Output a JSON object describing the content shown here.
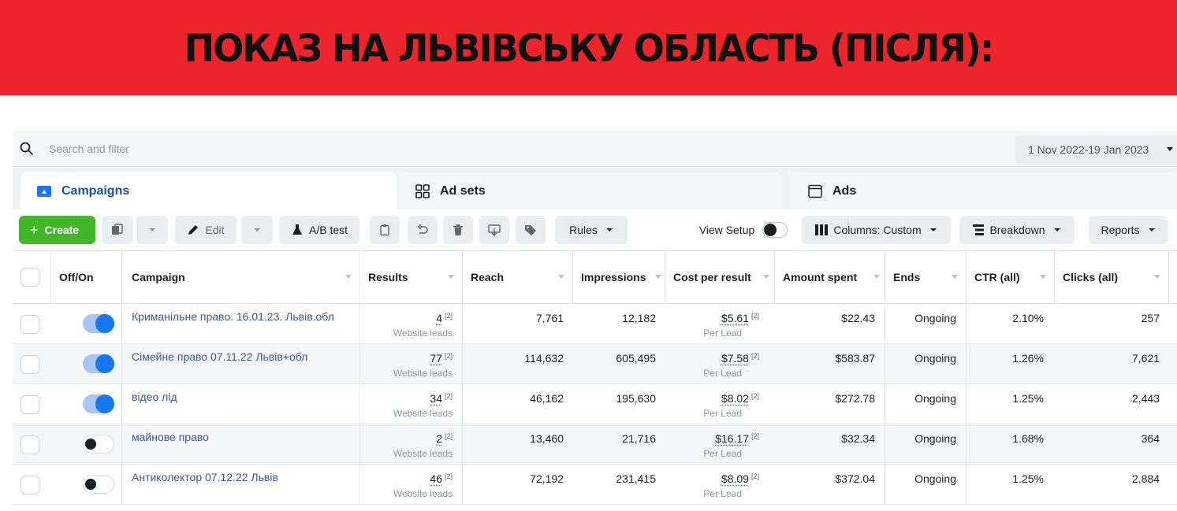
{
  "banner": {
    "title": "ПОКАЗ НА ЛЬВІВСЬКУ ОБЛАСТЬ (ПІСЛЯ):"
  },
  "search": {
    "placeholder": "Search and filter"
  },
  "date_range": "1 Nov 2022-19 Jan 2023",
  "tabs": [
    {
      "label": "Campaigns",
      "icon": "folder-icon",
      "active": true
    },
    {
      "label": "Ad sets",
      "icon": "grid-icon",
      "active": false
    },
    {
      "label": "Ads",
      "icon": "ad-window-icon",
      "active": false
    }
  ],
  "toolbar": {
    "create_label": "Create",
    "edit_label": "Edit",
    "ab_test_label": "A/B test",
    "rules_label": "Rules",
    "view_setup_label": "View Setup",
    "columns_label": "Columns: Custom",
    "breakdown_label": "Breakdown",
    "reports_label": "Reports"
  },
  "columns": [
    "Off/On",
    "Campaign",
    "Results",
    "Reach",
    "Impressions",
    "Cost per result",
    "Amount spent",
    "Ends",
    "CTR (all)",
    "Clicks (all)"
  ],
  "rows": [
    {
      "on": true,
      "campaign": "Криманільне право. 16.01.23. Львів.обл",
      "results": "4",
      "results_sub": "Website leads",
      "reach": "7,761",
      "impressions": "12,182",
      "cpr": "$5.61",
      "cpr_sub": "Per Lead",
      "spent": "$22.43",
      "ends": "Ongoing",
      "ctr": "2.10%",
      "clicks": "257"
    },
    {
      "on": true,
      "campaign": "Сімейне право 07.11.22 Львів+обл",
      "results": "77",
      "results_sub": "Website leads",
      "reach": "114,632",
      "impressions": "605,495",
      "cpr": "$7.58",
      "cpr_sub": "Per Lead",
      "spent": "$583.87",
      "ends": "Ongoing",
      "ctr": "1.26%",
      "clicks": "7,621"
    },
    {
      "on": true,
      "campaign": "відео лід",
      "results": "34",
      "results_sub": "Website leads",
      "reach": "46,162",
      "impressions": "195,630",
      "cpr": "$8.02",
      "cpr_sub": "Per Lead",
      "spent": "$272.78",
      "ends": "Ongoing",
      "ctr": "1.25%",
      "clicks": "2,443"
    },
    {
      "on": false,
      "campaign": "майнове право",
      "results": "2",
      "results_sub": "Website leads",
      "reach": "13,460",
      "impressions": "21,716",
      "cpr": "$16.17",
      "cpr_sub": "Per Lead",
      "spent": "$32.34",
      "ends": "Ongoing",
      "ctr": "1.68%",
      "clicks": "364"
    },
    {
      "on": false,
      "campaign": "Антиколектор 07.12.22 Львів",
      "results": "46",
      "results_sub": "Website leads",
      "reach": "72,192",
      "impressions": "231,415",
      "cpr": "$8.09",
      "cpr_sub": "Per Lead",
      "spent": "$372.04",
      "ends": "Ongoing",
      "ctr": "1.25%",
      "clicks": "2,884"
    }
  ],
  "ref_marker": "[2]",
  "colors": {
    "banner": "#ec242b",
    "create": "#42b72a",
    "toggle_on": "#1877f2",
    "link": "#385898"
  }
}
